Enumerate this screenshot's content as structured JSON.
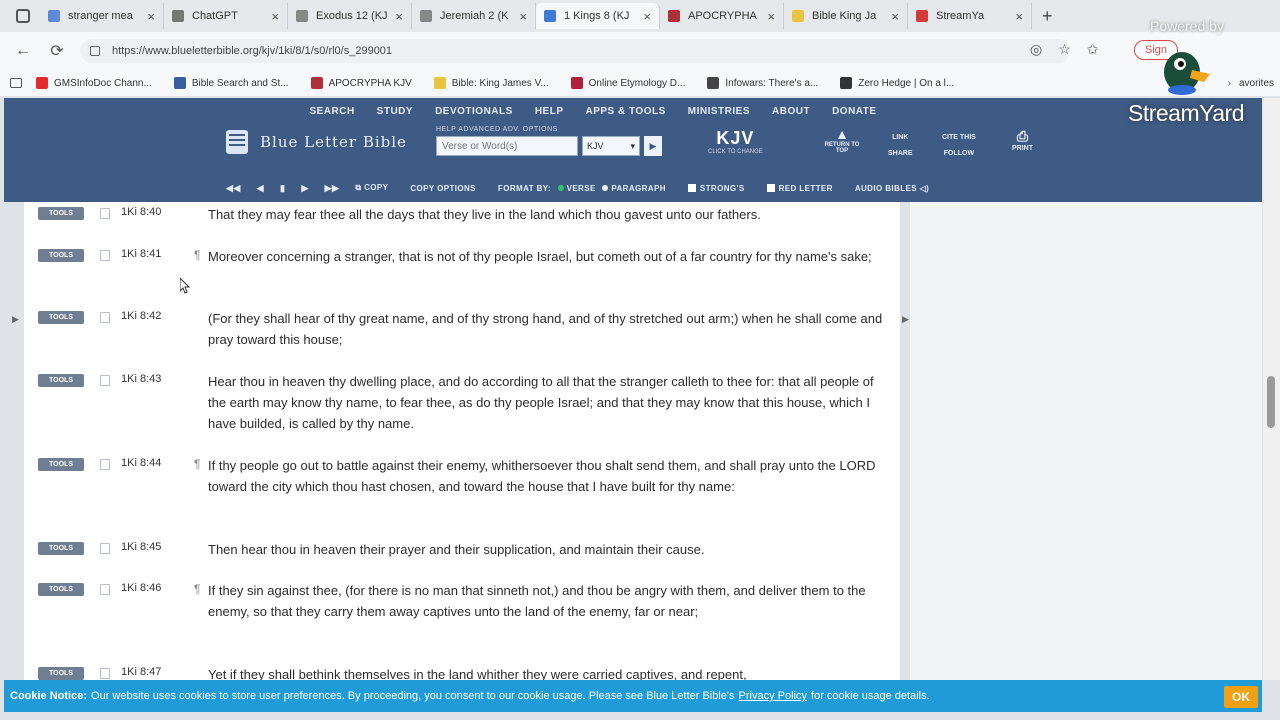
{
  "browser": {
    "tabs": [
      {
        "label": "stranger mea",
        "color": "#5b8ad6"
      },
      {
        "label": "ChatGPT",
        "color": "#777777"
      },
      {
        "label": "Exodus 12 (KJ",
        "color": "#888888"
      },
      {
        "label": "Jeremiah 2 (K",
        "color": "#888888"
      },
      {
        "label": "1 Kings 8 (KJ",
        "color": "#3e7ad6"
      },
      {
        "label": "APOCRYPHA",
        "color": "#b0303a"
      },
      {
        "label": "Bible King Ja",
        "color": "#e8c441"
      },
      {
        "label": "StreamYa",
        "color": "#d23b3b"
      }
    ],
    "url": "https://www.blueletterbible.org/kjv/1ki/8/1/s0/rl0/s_299001",
    "signin_label": "Sign",
    "bookmarks": [
      {
        "label": "GMSInfoDoc Chann...",
        "color": "#e22b2b"
      },
      {
        "label": "Bible Search and St...",
        "color": "#3a5ea0"
      },
      {
        "label": "APOCRYPHA KJV",
        "color": "#b0303a"
      },
      {
        "label": "Bible: King James V...",
        "color": "#e8c441"
      },
      {
        "label": "Online Etymology D...",
        "color": "#b0203a"
      },
      {
        "label": "Infowars: There's a...",
        "color": "#444444"
      },
      {
        "label": "Zero Hedge | On a l...",
        "color": "#333333"
      }
    ],
    "favorites_label": "avorites"
  },
  "site": {
    "nav": [
      "SEARCH",
      "STUDY",
      "DEVOTIONALS",
      "HELP",
      "APPS & TOOLS",
      "MINISTRIES",
      "ABOUT",
      "DONATE"
    ],
    "brand": "Blue Letter Bible",
    "search_options": "HELP   ADVANCED   ADV. OPTIONS",
    "search_placeholder": "Verse or Word(s)",
    "version": "KJV",
    "version_big": "KJV",
    "version_hint": "CLICK TO CHANGE",
    "return_top": "RETURN TO TOP",
    "link": "LINK",
    "share": "SHARE",
    "cite": "CITE THIS",
    "follow": "FOLLOW",
    "print": "PRINT",
    "copy": "COPY",
    "copy_options": "COPY OPTIONS",
    "format_by": "FORMAT BY:",
    "verse": "VERSE",
    "paragraph": "PARAGRAPH",
    "strongs": "STRONG'S",
    "red_letter": "RED LETTER",
    "audio_bibles": "AUDIO BIBLES"
  },
  "verses": [
    {
      "ref": "1Ki 8:40",
      "para": false,
      "text": "That they may fear thee all the days that they live in the land which thou gavest unto our fathers."
    },
    {
      "ref": "1Ki 8:41",
      "para": true,
      "text": "Moreover concerning a stranger, that is not of thy people Israel, but cometh out of a far country for thy name's sake;"
    },
    {
      "ref": "1Ki 8:42",
      "para": false,
      "text": "(For they shall hear of thy great name, and of thy strong hand, and of thy stretched out arm;) when he shall come and pray toward this house;"
    },
    {
      "ref": "1Ki 8:43",
      "para": false,
      "text": "Hear thou in heaven thy dwelling place, and do according to all that the stranger calleth to thee for: that all people of the earth may know thy name, to fear thee, as do thy people Israel; and that they may know that this house, which I have builded, is called by thy name."
    },
    {
      "ref": "1Ki 8:44",
      "para": true,
      "text": "If thy people go out to battle against their enemy, whithersoever thou shalt send them, and shall pray unto the LORD toward the city which thou hast chosen, and toward the house that I have built for thy name:"
    },
    {
      "ref": "1Ki 8:45",
      "para": false,
      "text": "Then hear thou in heaven their prayer and their supplication, and maintain their cause."
    },
    {
      "ref": "1Ki 8:46",
      "para": true,
      "text": "If they sin against thee, (for there is no man that sinneth not,) and thou be angry with them, and deliver them to the enemy, so that they carry them away captives unto the land of the enemy, far or near;"
    },
    {
      "ref": "1Ki 8:47",
      "para": false,
      "text": "Yet if they shall bethink themselves in the land whither they were carried captives, and repent,"
    }
  ],
  "tools_label": "TOOLS",
  "cookie": {
    "title": "Cookie Notice:",
    "text": "Our website uses cookies to store user preferences. By proceeding, you consent to our cookie usage. Please see Blue Letter Bible's",
    "link": "Privacy Policy",
    "tail": "for cookie usage details.",
    "ok": "OK"
  },
  "overlay": {
    "powered_by": "Powered by",
    "brand": "StreamYard"
  },
  "colors": {
    "header": "#3e5b85",
    "cookie": "#1f9bd7",
    "ok": "#f0a013"
  }
}
